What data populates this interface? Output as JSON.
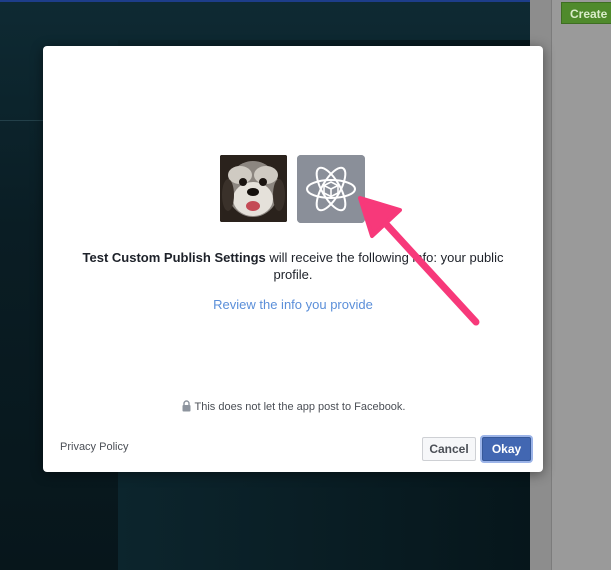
{
  "background": {
    "create_button_label": "Create"
  },
  "dialog": {
    "app_name": "Test Custom Publish Settings",
    "info_text": " will receive the following info: your public profile.",
    "review_link": "Review the info you provide",
    "notice": "This does not let the app post to Facebook.",
    "privacy_link": "Privacy Policy",
    "cancel_label": "Cancel",
    "okay_label": "Okay"
  },
  "icons": {
    "app": "atom-cube-icon",
    "lock": "lock-icon",
    "annotation": "pink-arrow-icon"
  },
  "colors": {
    "accent_blue": "#4267b2",
    "link_blue": "#5b8fd9",
    "arrow_pink": "#f7397a",
    "create_green": "#4f8a2c"
  }
}
